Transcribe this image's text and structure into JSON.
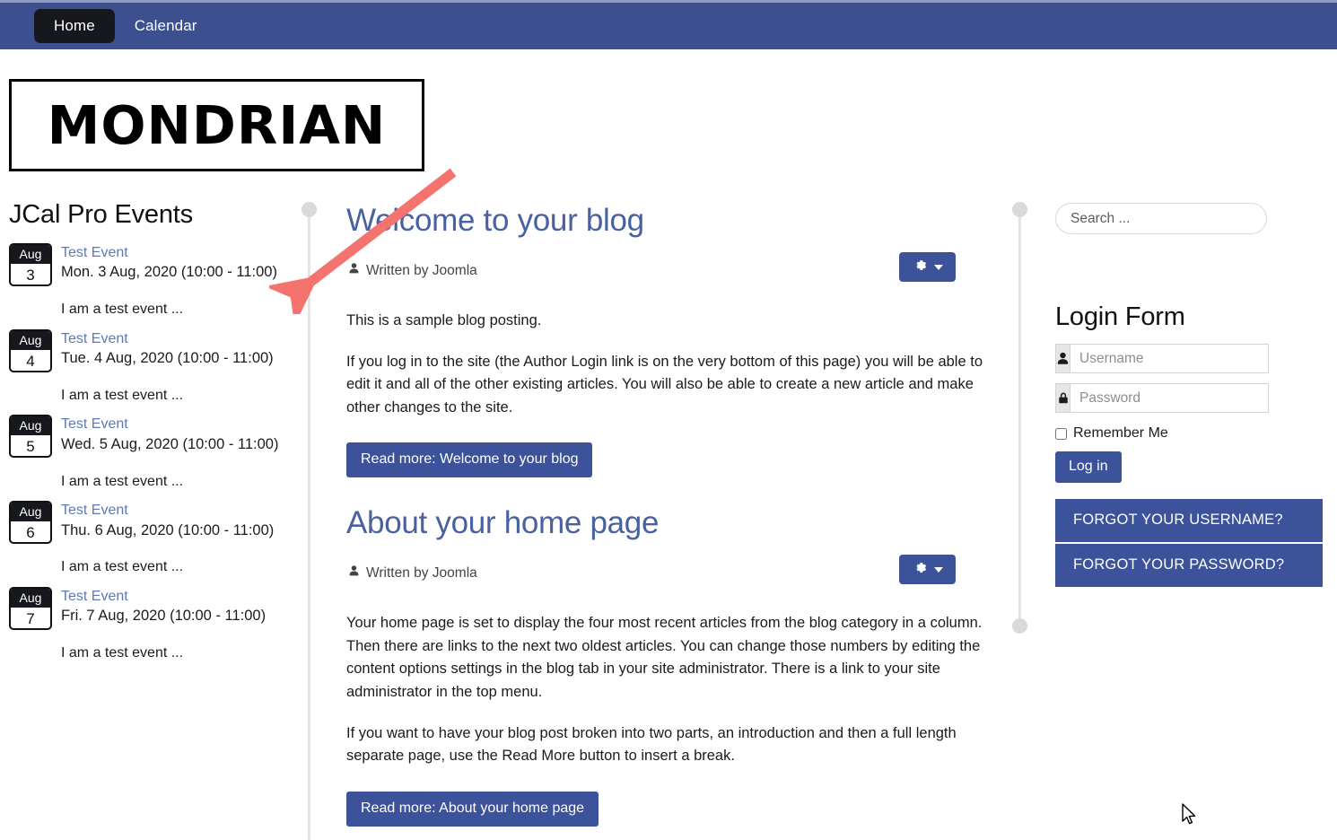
{
  "navbar": {
    "items": [
      {
        "label": "Home",
        "active": true
      },
      {
        "label": "Calendar",
        "active": false
      }
    ]
  },
  "logo": {
    "text": "MONDRIAN"
  },
  "sidebar_left": {
    "module_title": "JCal Pro Events",
    "events": [
      {
        "month": "Aug",
        "day": "3",
        "title": "Test Event",
        "when": "Mon. 3 Aug, 2020 (10:00 - 11:00)",
        "desc": "I am a test event ..."
      },
      {
        "month": "Aug",
        "day": "4",
        "title": "Test Event",
        "when": "Tue. 4 Aug, 2020 (10:00 - 11:00)",
        "desc": "I am a test event ..."
      },
      {
        "month": "Aug",
        "day": "5",
        "title": "Test Event",
        "when": "Wed. 5 Aug, 2020 (10:00 - 11:00)",
        "desc": "I am a test event ..."
      },
      {
        "month": "Aug",
        "day": "6",
        "title": "Test Event",
        "when": "Thu. 6 Aug, 2020 (10:00 - 11:00)",
        "desc": "I am a test event ..."
      },
      {
        "month": "Aug",
        "day": "7",
        "title": "Test Event",
        "when": "Fri. 7 Aug, 2020 (10:00 - 11:00)",
        "desc": "I am a test event ..."
      }
    ]
  },
  "main": {
    "articles": [
      {
        "title": "Welcome to your blog",
        "byline": "Written by Joomla",
        "byline_icon": "user-icon",
        "options_icon": "gear-icon",
        "paragraphs": [
          "This is a sample blog posting.",
          "If you log in to the site (the Author Login link is on the very bottom of this page) you will be able to edit it and all of the other existing articles. You will also be able to create a new article and make other changes to the site."
        ],
        "readmore_label": "Read more: Welcome to your blog"
      },
      {
        "title": "About your home page",
        "byline": "Written by Joomla",
        "byline_icon": "user-icon",
        "options_icon": "gear-icon",
        "paragraphs": [
          "Your home page is set to display the four most recent articles from the blog category in a column. Then there are links to the next two oldest articles. You can change those numbers by editing the content options settings in the blog tab in your site administrator. There is a link to your site administrator in the top menu.",
          "If you want to have your blog post broken into two parts, an introduction and then a full length separate page, use the Read More button to insert a break."
        ],
        "readmore_label": "Read more: About your home page"
      }
    ]
  },
  "sidebar_right": {
    "search": {
      "placeholder": "Search ...",
      "value": ""
    },
    "login": {
      "title": "Login Form",
      "username": {
        "placeholder": "Username",
        "value": "",
        "icon": "user-icon"
      },
      "password": {
        "placeholder": "Password",
        "value": "",
        "icon": "lock-icon"
      },
      "remember_label": "Remember Me",
      "remember_checked": false,
      "login_label": "Log in",
      "forgot": [
        {
          "label": "FORGOT YOUR USERNAME?"
        },
        {
          "label": "FORGOT YOUR PASSWORD?"
        }
      ]
    }
  },
  "overlays": {
    "arrow": {
      "name": "red-arrow-annotation",
      "color": "#f4736e"
    },
    "cursor": {
      "name": "mouse-cursor"
    }
  },
  "colors": {
    "navbar_bg": "#3c4f8f",
    "nav_active_bg": "#16181d",
    "accent_blue": "#3c529a",
    "heading_blue": "#49619e",
    "link_blue": "#5a7ab5",
    "divider_gray": "#e4e4e4",
    "annotation_red": "#f4736e"
  }
}
